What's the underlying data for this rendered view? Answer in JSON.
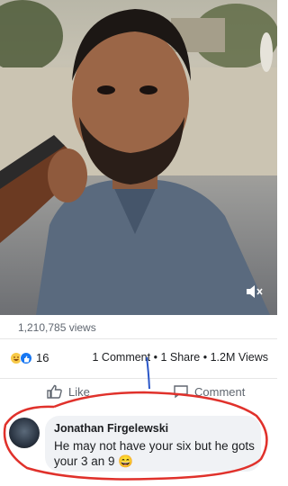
{
  "video": {
    "mute_icon": "volume-mute-icon"
  },
  "views": {
    "label": "1,210,785 views"
  },
  "stats": {
    "reaction_icons": [
      "haha-icon",
      "like-icon"
    ],
    "reaction_count": "16",
    "comments": "1 Comment",
    "shares": "1 Share",
    "views": "1.2M Views",
    "separator": "•"
  },
  "actions": {
    "like_label": "Like",
    "comment_label": "Comment"
  },
  "comment": {
    "author": "Jonathan Firgelewski",
    "text": "He may not have your six but he gots your 3 an 9 😄"
  },
  "colors": {
    "link_blue": "#1877f2",
    "annotation_red": "#e0312b",
    "annotation_blue": "#2b57c8"
  }
}
